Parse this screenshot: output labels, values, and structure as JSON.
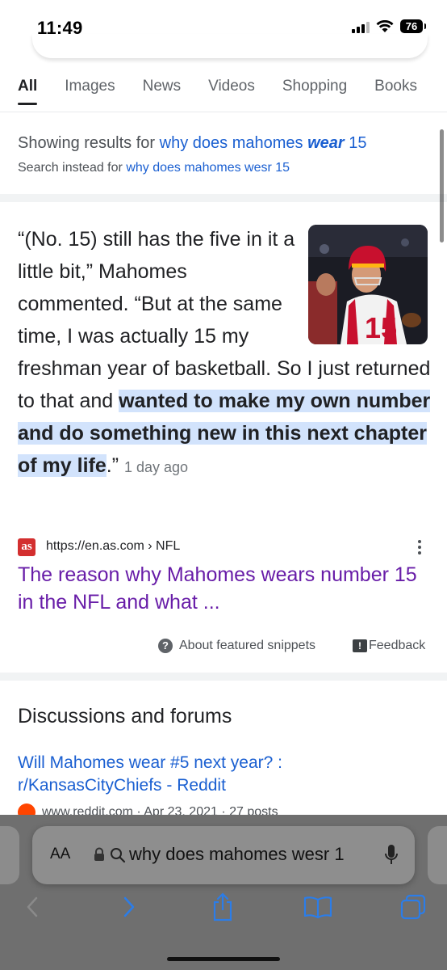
{
  "status": {
    "time": "11:49",
    "battery": "76"
  },
  "tabs": [
    {
      "label": "All",
      "active": true
    },
    {
      "label": "Images"
    },
    {
      "label": "News"
    },
    {
      "label": "Videos"
    },
    {
      "label": "Shopping"
    },
    {
      "label": "Books"
    }
  ],
  "spell": {
    "showing_prefix": "Showing results for",
    "corrected_a": "why does mahomes",
    "corrected_b": "wear",
    "corrected_c": "15",
    "instead_prefix": "Search instead for",
    "original_query": "why does mahomes wesr 15"
  },
  "snippet": {
    "text_plain": "“(No. 15) still has the five in it a little bit,” Mahomes commented. “But at the same time, I was actually 15 my freshman year of basketball. So I just returned to that and ",
    "text_highlight": "wanted to make my own number and do something new in this next chapter of my life",
    "text_end": ".”",
    "date": "1 day ago",
    "favicon": "as",
    "url": "https://en.as.com › NFL",
    "title": "The reason why Mahomes wears number 15 in the NFL and what ...",
    "about_label": "About featured snippets",
    "feedback_label": "Feedback"
  },
  "discussions": {
    "heading": "Discussions and forums",
    "link": "Will Mahomes wear #5 next year? : r/KansasCityChiefs - Reddit",
    "meta": "www.reddit.com · Apr 23, 2021 · 27 posts"
  },
  "safari": {
    "aa": "AA",
    "address": "why does mahomes wesr 1"
  },
  "colors": {
    "link": "#1a5fd1",
    "visited": "#681da8",
    "highlight": "#d2e3fc"
  }
}
